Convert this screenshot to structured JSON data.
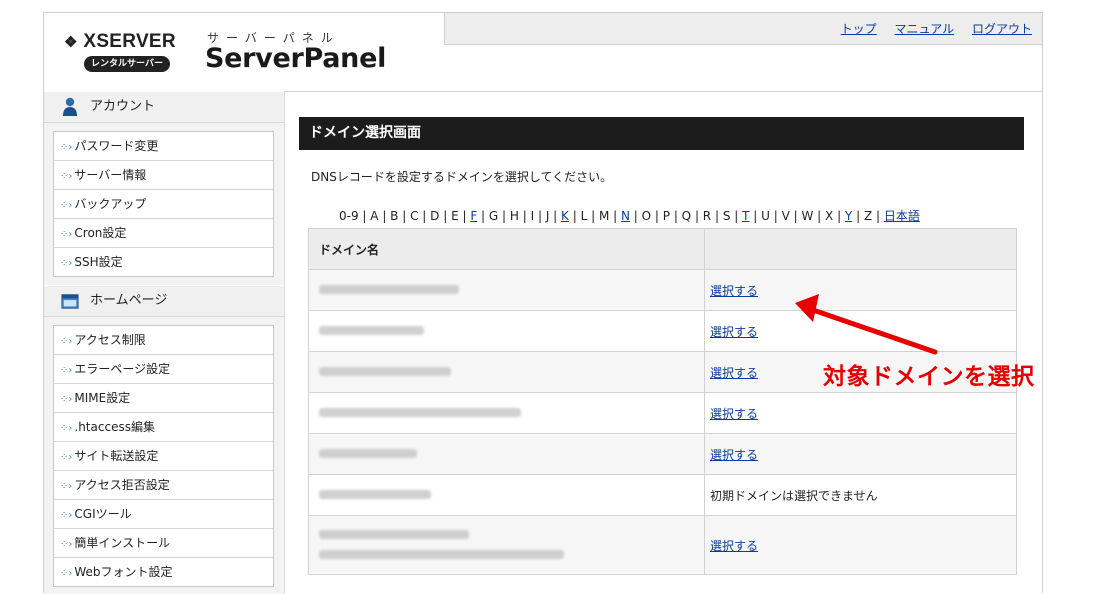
{
  "logo": {
    "brand": "XSERVER",
    "badge": "レンタルサーバー",
    "subtitle": "サーバーパネル",
    "title": "ServerPanel"
  },
  "topnav": {
    "links": [
      "トップ",
      "マニュアル",
      "ログアウト"
    ]
  },
  "sidebar": {
    "sections": [
      {
        "title": "アカウント",
        "icon": "person-icon",
        "items": [
          "パスワード変更",
          "サーバー情報",
          "バックアップ",
          "Cron設定",
          "SSH設定"
        ]
      },
      {
        "title": "ホームページ",
        "icon": "window-icon",
        "items": [
          "アクセス制限",
          "エラーページ設定",
          "MIME設定",
          ".htaccess編集",
          "サイト転送設定",
          "アクセス拒否設定",
          "CGIツール",
          "簡単インストール",
          "Webフォント設定"
        ]
      }
    ]
  },
  "main": {
    "title": "ドメイン選択画面",
    "description": "DNSレコードを設定するドメインを選択してください。",
    "alpha_index": [
      {
        "t": "0-9",
        "link": false
      },
      {
        "t": "A",
        "link": false
      },
      {
        "t": "B",
        "link": false
      },
      {
        "t": "C",
        "link": false
      },
      {
        "t": "D",
        "link": false
      },
      {
        "t": "E",
        "link": false
      },
      {
        "t": "F",
        "link": true
      },
      {
        "t": "G",
        "link": false
      },
      {
        "t": "H",
        "link": false
      },
      {
        "t": "I",
        "link": false
      },
      {
        "t": "J",
        "link": false
      },
      {
        "t": "K",
        "link": true
      },
      {
        "t": "L",
        "link": false
      },
      {
        "t": "M",
        "link": false
      },
      {
        "t": "N",
        "link": true
      },
      {
        "t": "O",
        "link": false
      },
      {
        "t": "P",
        "link": false
      },
      {
        "t": "Q",
        "link": false
      },
      {
        "t": "R",
        "link": false
      },
      {
        "t": "S",
        "link": false
      },
      {
        "t": "T",
        "link": true
      },
      {
        "t": "U",
        "link": false
      },
      {
        "t": "V",
        "link": false
      },
      {
        "t": "W",
        "link": false
      },
      {
        "t": "X",
        "link": false
      },
      {
        "t": "Y",
        "link": true
      },
      {
        "t": "Z",
        "link": false
      },
      {
        "t": "日本語",
        "link": true
      }
    ],
    "table": {
      "header": "ドメイン名",
      "select_label": "選択する",
      "initial_domain_note": "初期ドメインは選択できません"
    }
  },
  "annotation": {
    "text": "対象ドメインを選択",
    "color": "#e60000"
  }
}
